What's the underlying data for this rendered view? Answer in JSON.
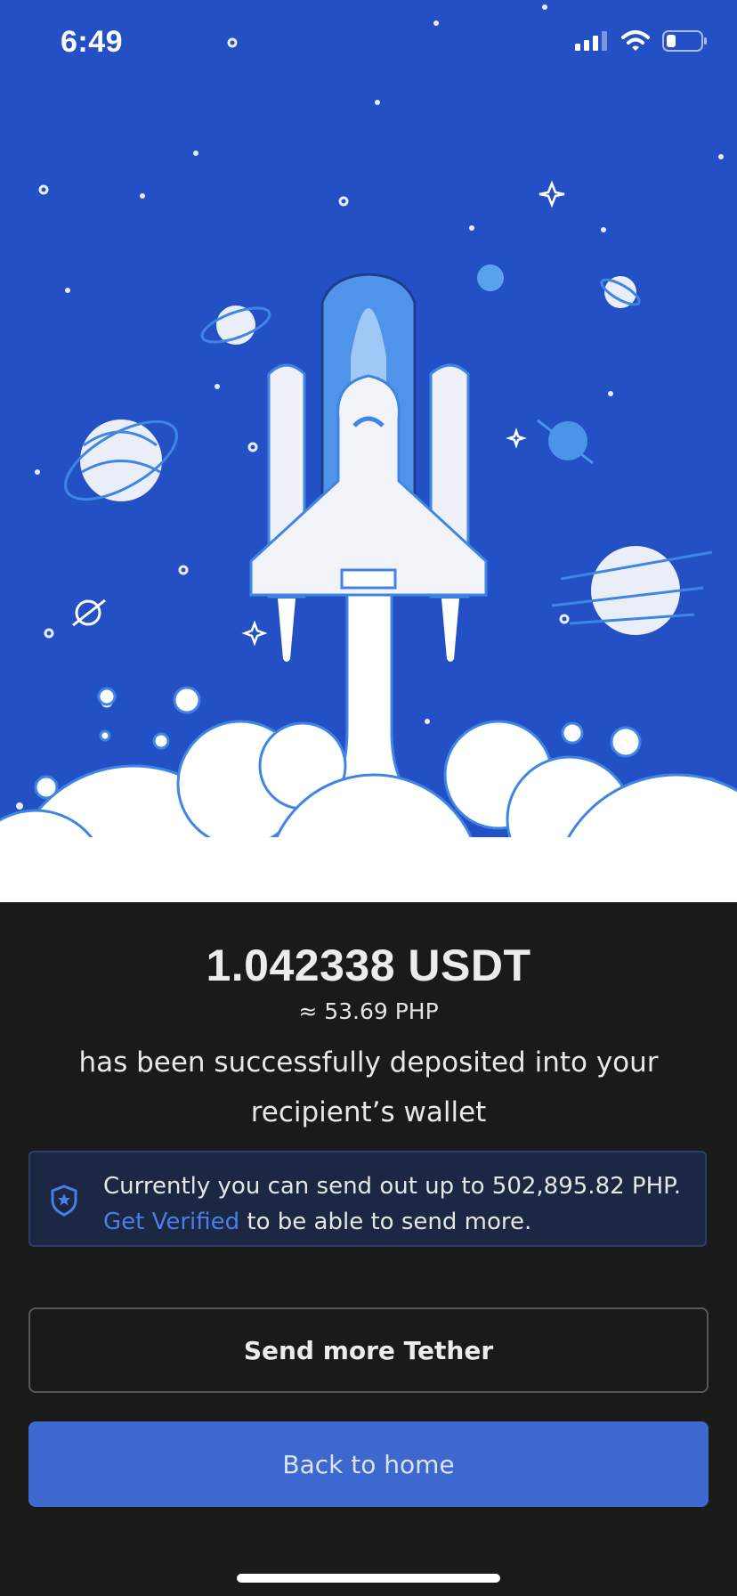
{
  "status_bar": {
    "time": "6:49",
    "icons": [
      "signal-icon",
      "wifi-icon",
      "battery-icon"
    ]
  },
  "hero": {
    "illustration": "rocket-launch-icon",
    "background_color": "#2450c6"
  },
  "deposit": {
    "amount": "1.042338 USDT",
    "approx": "≈ 53.69 PHP",
    "message": "has been successfully deposited into your recipient’s wallet"
  },
  "notice": {
    "icon": "shield-star-icon",
    "text_prefix": "Currently you can send out up to 502,895.82 PHP.",
    "link": "Get Verified",
    "text_suffix": "to be able to send more."
  },
  "buttons": {
    "send_more": "Send more Tether",
    "back_home": "Back to home"
  },
  "colors": {
    "accent": "#3d68d0",
    "link": "#4a7ee8",
    "background": "#1a1a1a"
  }
}
